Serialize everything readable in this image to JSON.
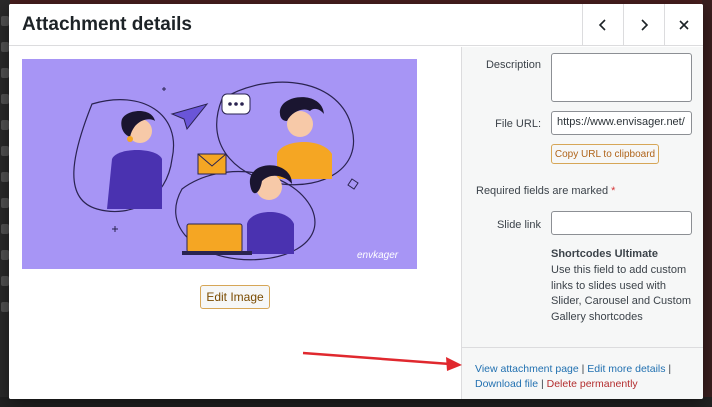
{
  "modal": {
    "title": "Attachment details"
  },
  "image": {
    "watermark": "envkager"
  },
  "left": {
    "edit_image_label": "Edit Image"
  },
  "details": {
    "description_label": "Description",
    "description_value": "",
    "file_url_label": "File URL:",
    "file_url_value": "https://www.envisager.net/",
    "copy_url_label": "Copy URL to clipboard",
    "required_text": "Required fields are marked",
    "required_star": "*",
    "slide_link_label": "Slide link",
    "slide_link_value": "",
    "shortcodes_title": "Shortcodes Ultimate",
    "shortcodes_desc": "Use this field to add custom links to slides used with Slider, Carousel and Custom Gallery shortcodes"
  },
  "actions": {
    "view_page": "View attachment page",
    "edit_more": "Edit more details",
    "download": "Download file",
    "delete": "Delete permanently",
    "separator": " | "
  },
  "colors": {
    "accent_link": "#2271b1",
    "delete": "#b32d2e",
    "annotation_arrow": "#e0282e",
    "illustration_bg": "#a795f5"
  },
  "icons": {
    "prev": "chevron-left-icon",
    "next": "chevron-right-icon",
    "close": "close-icon"
  }
}
